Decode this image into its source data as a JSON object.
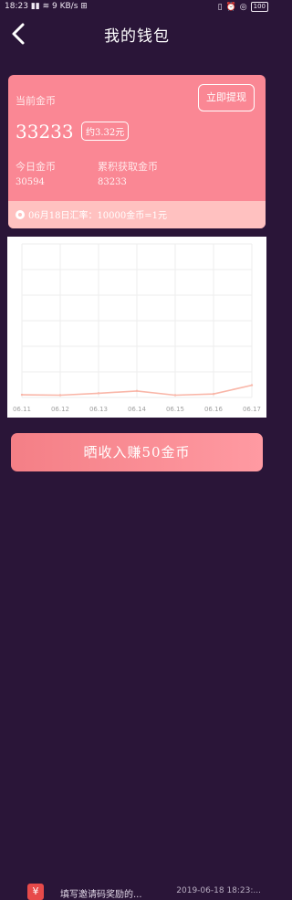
{
  "status_bar": {
    "time": "18:23",
    "network_speed": "9 KB/s",
    "battery": "100"
  },
  "header": {
    "title": "我的钱包",
    "back_icon": "chevron-left-icon"
  },
  "wallet_card": {
    "current_coins_label": "当前金币",
    "current_coins_value": "33233",
    "approx_value": "约3.32元",
    "withdraw_label": "立即提现",
    "today_label": "今日金币",
    "today_value": "30594",
    "total_label": "累积获取金币",
    "total_value": "83233",
    "rate_text": "06月18日汇率：10000金币=1元"
  },
  "chart_data": {
    "type": "line",
    "categories": [
      "06.11",
      "06.12",
      "06.13",
      "06.14",
      "06.15",
      "06.16",
      "06.17"
    ],
    "values": [
      0.35,
      0.3,
      0.55,
      0.85,
      0.3,
      0.45,
      1.6
    ],
    "ylim": [
      0,
      20
    ],
    "title": "",
    "xlabel": "",
    "ylabel": "",
    "grid": true,
    "line_color": "#f9b6a8"
  },
  "bottom": {
    "share_button_label": "晒收入赚50金币",
    "invite_text": "填写邀请码奖励的...",
    "invite_time": "2019-06-18 18:23:..."
  }
}
